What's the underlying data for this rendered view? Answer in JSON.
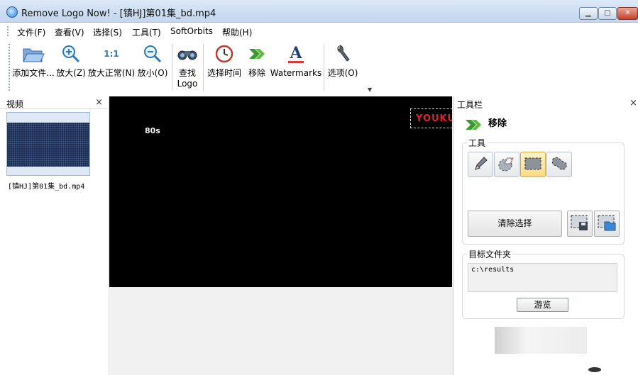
{
  "window": {
    "title": "Remove Logo Now! - [镇HJ]第01集_bd.mp4",
    "controls": {
      "minimize": "▁",
      "maximize": "□",
      "close": "✕"
    }
  },
  "menu": [
    "文件(F)",
    "查看(V)",
    "选择(S)",
    "工具(T)",
    "SoftOrbits",
    "帮助(H)"
  ],
  "toolbar": {
    "buttons": [
      {
        "label": "添加文件...",
        "icon": "folder-open-icon"
      },
      {
        "label": "放大(Z)",
        "icon": "zoom-in-icon"
      },
      {
        "label": "放大正常(N)",
        "icon": "zoom-normal-icon",
        "glyph": "1:1"
      },
      {
        "label": "放小(O)",
        "icon": "zoom-out-icon"
      },
      {
        "label": "查找\nLogo",
        "label_line1": "查找",
        "label_line2": "Logo",
        "icon": "binoculars-icon"
      },
      {
        "label": "选择时间",
        "icon": "clock-icon"
      },
      {
        "label": "移除",
        "icon": "green-arrow-icon"
      },
      {
        "label": "Watermarks",
        "icon": "text-a-icon",
        "glyph": "A"
      },
      {
        "label": "选项(O)",
        "icon": "wrench-icon"
      }
    ]
  },
  "video_panel": {
    "title": "视频",
    "close": "×",
    "file_label": "[镇HJ]第01集_bd.mp4"
  },
  "viewer": {
    "timecode": "80s",
    "detected_logo": "YOUKU"
  },
  "tool_panel": {
    "title": "工具栏",
    "close": "×",
    "action_label": "移除",
    "tools_group": "工具",
    "tools": [
      "pencil-icon",
      "eraser-icon",
      "rect-select-icon",
      "lasso-icon"
    ],
    "active_tool_index": 2,
    "clear_label": "清除选择",
    "target_group": "目标文件夹",
    "target_path": "c:\\results",
    "browse_label": "游览"
  },
  "colors": {
    "titlebar": "#c3d6ee",
    "accent_green": "#3a9a2e",
    "logo_red": "#e2202c",
    "active_tool": "#f9dc83"
  }
}
